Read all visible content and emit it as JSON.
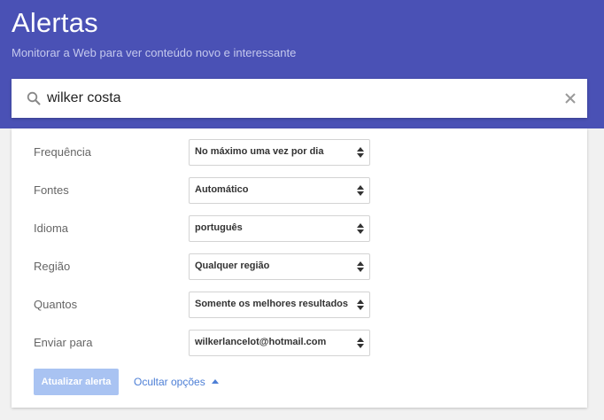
{
  "header": {
    "title": "Alertas",
    "subtitle": "Monitorar a Web para ver conteúdo novo e interessante"
  },
  "search": {
    "value": "wilker costa"
  },
  "options": [
    {
      "label": "Frequência",
      "value": "No máximo uma vez por dia"
    },
    {
      "label": "Fontes",
      "value": "Automático"
    },
    {
      "label": "Idioma",
      "value": "português"
    },
    {
      "label": "Região",
      "value": "Qualquer região"
    },
    {
      "label": "Quantos",
      "value": "Somente os melhores resultados"
    },
    {
      "label": "Enviar para",
      "value": "wilkerlancelot@hotmail.com"
    }
  ],
  "actions": {
    "update_label": "Atualizar alerta",
    "hide_options_label": "Ocultar opções"
  },
  "colors": {
    "header_bg": "#4a51b5",
    "button_disabled": "#a9c3f2",
    "link": "#4d7fd6"
  }
}
